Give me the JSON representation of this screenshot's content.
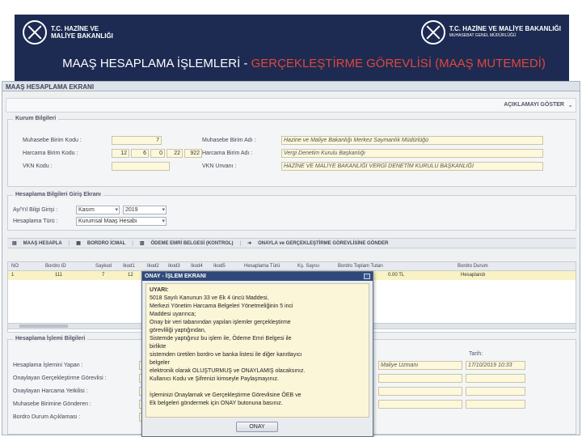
{
  "banner": {
    "left_logo": {
      "line1": "T.C. HAZİNE VE",
      "line2": "MALİYE BAKANLIĞI"
    },
    "right_logo": {
      "line1": "T.C. HAZİNE VE MALİYE BAKANLIĞI",
      "line2": "MUHASEBAT GENEL MÜDÜRLÜĞÜ"
    },
    "title_part1": "MAAŞ HESAPLAMA İŞLEMLERİ - ",
    "title_part2": "GERÇEKLEŞTİRME GÖREVLİSİ (MAAŞ MUTEMEDİ)",
    "title_color": "#ffffff",
    "highlight_color": "#e2463a",
    "banner_color": "#1d2b52"
  },
  "screen": {
    "title": "MAAŞ HESAPLAMA EKRANI",
    "expand_label": "AÇIKLAMAYI GÖSTER",
    "kurum": {
      "legend": "Kurum Bilgileri",
      "muhasebe_kodu_label": "Muhasebe Birim Kodu :",
      "muhasebe_kodu_value": "7",
      "harcama_kodu_label": "Harcama Birim Kodu :",
      "harcama_kodu_parts": [
        "12",
        "6",
        "0",
        "22",
        "922"
      ],
      "vkn_label": "VKN Kodu :",
      "vkn_value": "",
      "muhasebe_adi_label": "Muhasebe Birim Adı :",
      "muhasebe_adi_value": "Hazine ve Maliye Bakanlığı Merkez Saymanlık Müdürlüğü",
      "harcama_adi_label": "Harcama Birim Adı :",
      "harcama_adi_value": "Vergi Denetim Kurulu Başkanlığı",
      "vkn_unvan_label": "VKN Unvanı :",
      "vkn_unvan_value": "HAZİNE VE MALİYE BAKANLIĞI VERGİ DENETİM KURULU BAŞKANLIĞI"
    },
    "hesaplama": {
      "legend": "Hesaplama Bilgileri Giriş Ekranı",
      "ay_yil_label": "Ay/Yıl Bilgi Girişi :",
      "ay_value": "Kasım",
      "yil_value": "2019",
      "turu_label": "Hesaplama Türü :",
      "turu_value": "Kurumsal Maaş Hesabı"
    },
    "toolbar": {
      "maas_hesapla": "MAAŞ HESAPLA",
      "bordro_icmal": "BORDRO İCMAL",
      "odeme_emri": "ÖDEME EMRİ BELGESİ (KONTROL)",
      "onaya_gonder": "ONAYLA ve GERÇEKLEŞTİRME GÖREVLİSİNE GÖNDER"
    },
    "grid": {
      "headers": [
        "NO",
        "Bordro ID",
        "Saykod",
        "Ikod1",
        "Ikod2",
        "Ikod3",
        "Ikod4",
        "Ikod5",
        "Hesaplama Türü",
        "Kş. Sayısı",
        "Bordro Toplam Tutarı",
        "Bordro Durum"
      ],
      "row": [
        "1",
        "111",
        "7",
        "12",
        "",
        "",
        "",
        "",
        "",
        "",
        "0.00 TL",
        "Hesaplandı"
      ]
    },
    "islem": {
      "legend": "Hesaplama İşlemi Bilgileri",
      "yapan_label": "Hesaplama İşlemini Yapan :",
      "onaylayan_gg_label": "Onaylayan Gerçekleştirme Görevlisi :",
      "onaylayan_hy_label": "Onaylayan Harcama Yetkilisi :",
      "muhasebe_gonderen_label": "Muhasebe Birimine Gönderen :",
      "durum_label": "Bordro Durum Açıklaması :",
      "unvan_value": "Maliye Uzmanı",
      "tarih_label": "Tarih:",
      "tarih_value": "17/10/2019 10:33"
    }
  },
  "modal": {
    "title": "ONAY - İŞLEM EKRANI",
    "lines": [
      "UYARI:",
      "5018 Sayılı Kanunun 33 ve Ek 4 üncü Maddesi,",
      "Merkezi Yönetim Harcama Belgeleri Yönetmeliğinin 5 inci",
      "Maddesi uyarınca;",
      "Onay bir veri tabanından yapılan işlemler gerçekleştirme",
      "görevliliği yaptığından,",
      "Sistemde yaptığınız bu işlem ile, Ödeme Emri Belgesi ile",
      "birlikte",
      "sistemden üretilen bordro ve banka listesi ile diğer kanıtlayıcı",
      "belgeler",
      "elektronik olarak OLUŞTURMUŞ ve ONAYLAMIŞ olacaksınız.",
      "Kullanıcı Kodu ve Şifrenizi kimseyle Paylaşmayınız.",
      "",
      "İşleminizi Onaylamak ve Gerçekleştirme Görevlisine ÖEB ve",
      "Ek belgeleri göndermek için ONAY butonuna basınız."
    ],
    "ok_label": "ONAY"
  }
}
